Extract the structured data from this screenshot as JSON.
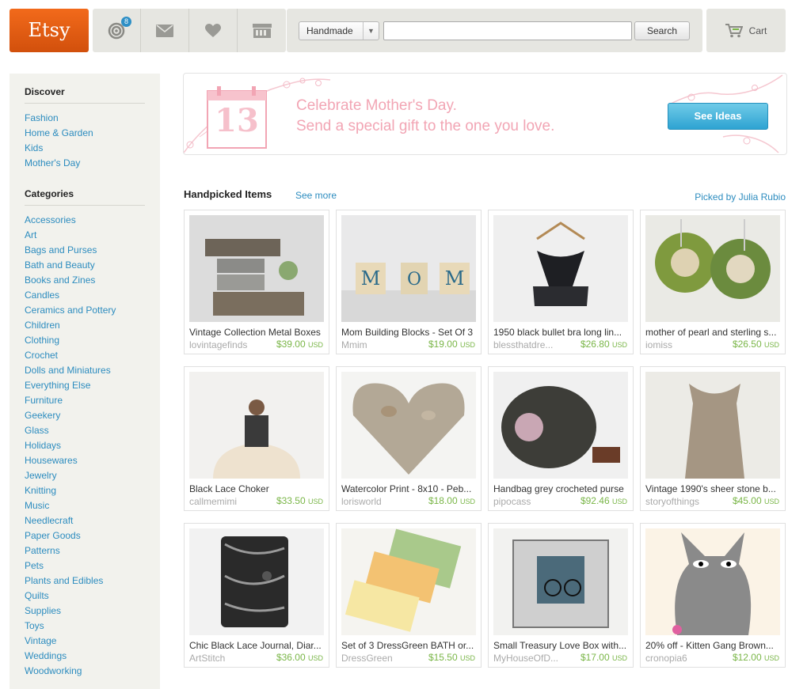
{
  "header": {
    "logo": "Etsy",
    "notifications_count": "8",
    "search": {
      "category": "Handmade",
      "query": "",
      "button": "Search"
    },
    "cart_label": "Cart"
  },
  "sidebar": {
    "discover_heading": "Discover",
    "discover": [
      "Fashion",
      "Home & Garden",
      "Kids",
      "Mother's Day"
    ],
    "categories_heading": "Categories",
    "categories": [
      "Accessories",
      "Art",
      "Bags and Purses",
      "Bath and Beauty",
      "Books and Zines",
      "Candles",
      "Ceramics and Pottery",
      "Children",
      "Clothing",
      "Crochet",
      "Dolls and Miniatures",
      "Everything Else",
      "Furniture",
      "Geekery",
      "Glass",
      "Holidays",
      "Housewares",
      "Jewelry",
      "Knitting",
      "Music",
      "Needlecraft",
      "Paper Goods",
      "Patterns",
      "Pets",
      "Plants and Edibles",
      "Quilts",
      "Supplies",
      "Toys",
      "Vintage",
      "Weddings",
      "Woodworking"
    ]
  },
  "banner": {
    "calendar_day": "13",
    "line1": "Celebrate Mother's Day.",
    "line2": "Send a special gift to the one you love.",
    "button": "See Ideas"
  },
  "handpicked": {
    "title": "Handpicked Items",
    "see_more": "See more",
    "picked_by": "Picked by Julia Rubio",
    "items": [
      {
        "title": "Vintage Collection Metal Boxes",
        "shop": "lovintagefinds",
        "price": "$39.00",
        "currency": "USD"
      },
      {
        "title": "Mom Building Blocks - Set Of 3",
        "shop": "Mmim",
        "price": "$19.00",
        "currency": "USD"
      },
      {
        "title": "1950 black bullet bra long lin...",
        "shop": "blessthatdre...",
        "price": "$26.80",
        "currency": "USD"
      },
      {
        "title": "mother of pearl and sterling s...",
        "shop": "iomiss",
        "price": "$26.50",
        "currency": "USD"
      },
      {
        "title": "Black Lace Choker",
        "shop": "callmemimi",
        "price": "$33.50",
        "currency": "USD"
      },
      {
        "title": "Watercolor Print - 8x10 - Peb...",
        "shop": "lorisworld",
        "price": "$18.00",
        "currency": "USD"
      },
      {
        "title": "Handbag grey crocheted purse",
        "shop": "pipocass",
        "price": "$92.46",
        "currency": "USD"
      },
      {
        "title": "Vintage 1990's sheer stone b...",
        "shop": "storyofthings",
        "price": "$45.00",
        "currency": "USD"
      },
      {
        "title": "Chic Black Lace Journal, Diar...",
        "shop": "ArtStitch",
        "price": "$36.00",
        "currency": "USD"
      },
      {
        "title": "Set of 3 DressGreen BATH or...",
        "shop": "DressGreen",
        "price": "$15.50",
        "currency": "USD"
      },
      {
        "title": "Small Treasury Love Box with...",
        "shop": "MyHouseOfD...",
        "price": "$17.00",
        "currency": "USD"
      },
      {
        "title": "20% off - Kitten Gang Brown...",
        "shop": "cronopia6",
        "price": "$12.00",
        "currency": "USD"
      }
    ]
  },
  "colors": {
    "brand_orange": "#f1641e",
    "link_blue": "#2c8cbf",
    "price_green": "#7ab648",
    "banner_pink": "#f2a5b4"
  }
}
